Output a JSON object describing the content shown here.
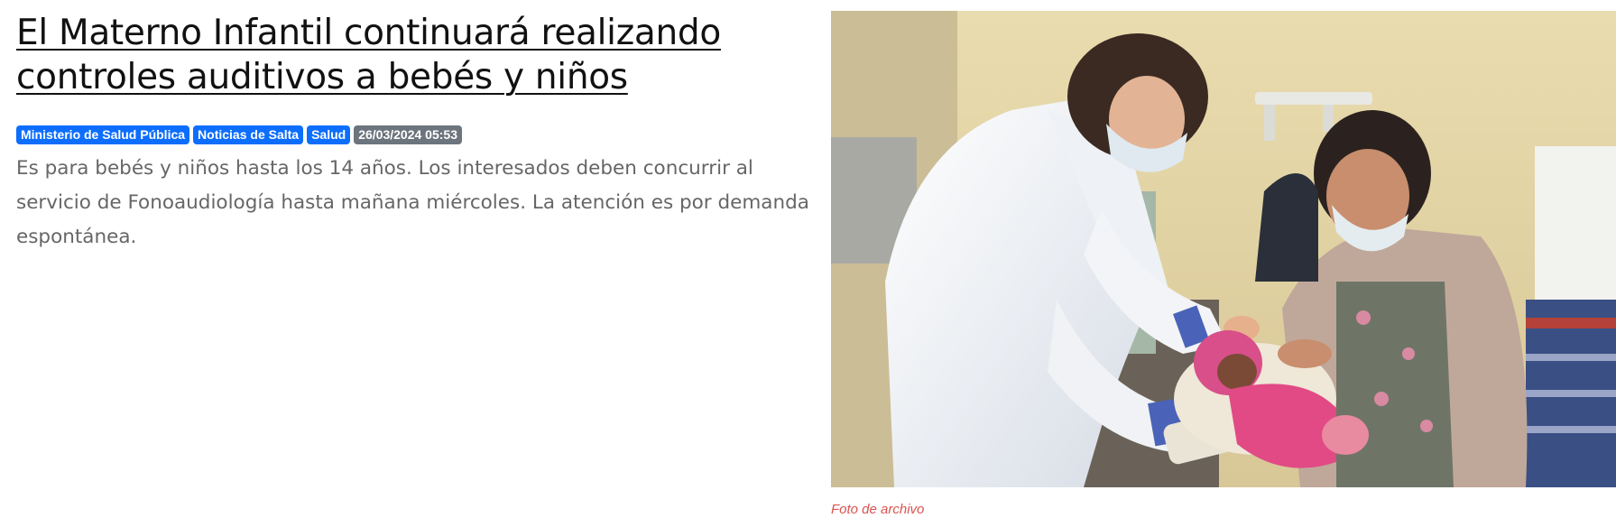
{
  "article": {
    "title": "El Materno Infantil continuará realizando controles auditivos a bebés y niños",
    "tags": [
      "Ministerio de Salud Pública",
      "Noticias de Salta",
      "Salud"
    ],
    "date": "26/03/2024 05:53",
    "summary": "Es para bebés y niños hasta los 14 años. Los interesados deben concurrir al servicio de Fonoaudiología hasta mañana miércoles. La atención es por demanda espontánea.",
    "photo_caption": "Foto de archivo"
  }
}
